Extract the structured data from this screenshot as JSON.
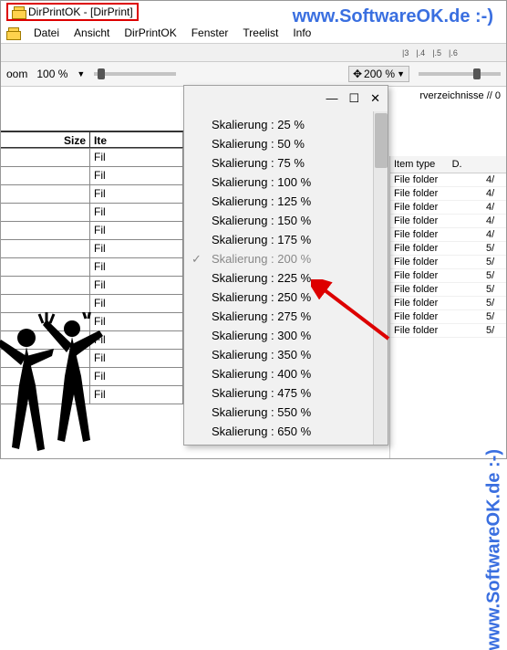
{
  "watermark": "www.SoftwareOK.de :-)",
  "titlebar": {
    "title": "DirPrintOK - [DirPrint]"
  },
  "menu": {
    "items": [
      "Datei",
      "Ansicht",
      "DirPrintOK",
      "Fenster",
      "Treelist",
      "Info"
    ]
  },
  "ruler": {
    "marks": [
      "|3",
      "|.4",
      "|.5",
      "|.6"
    ]
  },
  "zoom_left": {
    "label": "100 %",
    "prefix": "oom"
  },
  "zoom_right": {
    "label": "200 %"
  },
  "dropdown": {
    "ctrls": {
      "min": "—",
      "max": "☐",
      "close": "✕"
    },
    "scale_word": "Skalierung :",
    "items": [
      {
        "pct": "25 %",
        "checked": false
      },
      {
        "pct": "50 %",
        "checked": false
      },
      {
        "pct": "75 %",
        "checked": false
      },
      {
        "pct": "100 %",
        "checked": false
      },
      {
        "pct": "125 %",
        "checked": false
      },
      {
        "pct": "150 %",
        "checked": false
      },
      {
        "pct": "175 %",
        "checked": false
      },
      {
        "pct": "200 %",
        "checked": true
      },
      {
        "pct": "225 %",
        "checked": false
      },
      {
        "pct": "250 %",
        "checked": false
      },
      {
        "pct": "275 %",
        "checked": false
      },
      {
        "pct": "300 %",
        "checked": false
      },
      {
        "pct": "350 %",
        "checked": false
      },
      {
        "pct": "400 %",
        "checked": false
      },
      {
        "pct": "475 %",
        "checked": false
      },
      {
        "pct": "550 %",
        "checked": false
      },
      {
        "pct": "650 %",
        "checked": false
      }
    ]
  },
  "preview": {
    "header1": "Size",
    "header2": "Ite",
    "cell": "Fil",
    "rows": 14
  },
  "right_hint": "rverzeichnisse // 0",
  "right": {
    "h1": "Item type",
    "h2": "D.",
    "rows": [
      {
        "t": "File folder",
        "d": "4/"
      },
      {
        "t": "File folder",
        "d": "4/"
      },
      {
        "t": "File folder",
        "d": "4/"
      },
      {
        "t": "File folder",
        "d": "4/"
      },
      {
        "t": "File folder",
        "d": "4/"
      },
      {
        "t": "File folder",
        "d": "5/"
      },
      {
        "t": "File folder",
        "d": "5/"
      },
      {
        "t": "File folder",
        "d": "5/"
      },
      {
        "t": "File folder",
        "d": "5/"
      },
      {
        "t": "File folder",
        "d": "5/"
      },
      {
        "t": "File folder",
        "d": "5/"
      },
      {
        "t": "File folder",
        "d": "5/"
      }
    ]
  }
}
